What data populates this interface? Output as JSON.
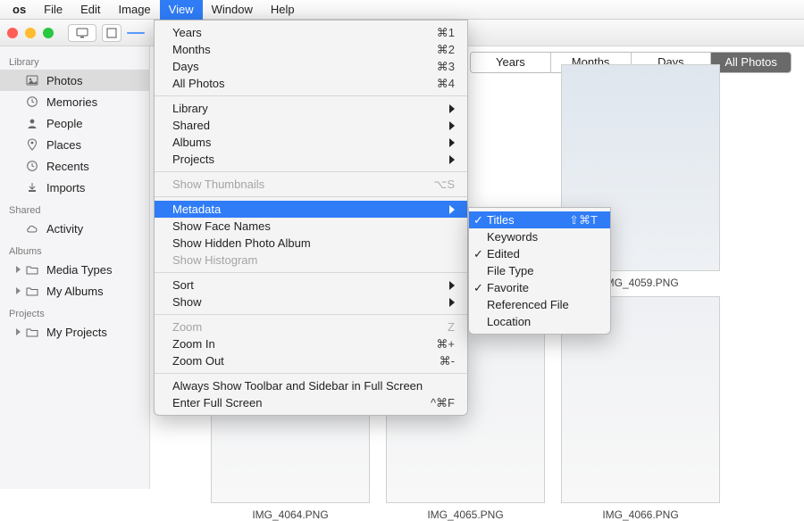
{
  "menubar": {
    "app": "os",
    "items": [
      "File",
      "Edit",
      "Image",
      "View",
      "Window",
      "Help"
    ],
    "active": "View"
  },
  "sidebar": {
    "groups": [
      {
        "header": "Library",
        "items": [
          {
            "label": "Photos",
            "icon": "photos-icon",
            "selected": true
          },
          {
            "label": "Memories",
            "icon": "clock-icon"
          },
          {
            "label": "People",
            "icon": "person-icon"
          },
          {
            "label": "Places",
            "icon": "pin-icon"
          },
          {
            "label": "Recents",
            "icon": "clock-icon"
          },
          {
            "label": "Imports",
            "icon": "download-icon"
          }
        ]
      },
      {
        "header": "Shared",
        "items": [
          {
            "label": "Activity",
            "icon": "cloud-icon"
          }
        ]
      },
      {
        "header": "Albums",
        "items": [
          {
            "label": "Media Types",
            "icon": "folder-icon",
            "disclosure": true
          },
          {
            "label": "My Albums",
            "icon": "folder-icon",
            "disclosure": true
          }
        ]
      },
      {
        "header": "Projects",
        "items": [
          {
            "label": "My Projects",
            "icon": "folder-icon",
            "disclosure": true
          }
        ]
      }
    ]
  },
  "segments": {
    "items": [
      "Years",
      "Months",
      "Days",
      "All Photos"
    ],
    "active": "All Photos"
  },
  "view_menu": [
    {
      "label": "Years",
      "shortcut": "⌘1"
    },
    {
      "label": "Months",
      "shortcut": "⌘2"
    },
    {
      "label": "Days",
      "shortcut": "⌘3"
    },
    {
      "label": "All Photos",
      "shortcut": "⌘4"
    },
    {
      "sep": true
    },
    {
      "label": "Library",
      "submenu": true
    },
    {
      "label": "Shared",
      "submenu": true
    },
    {
      "label": "Albums",
      "submenu": true
    },
    {
      "label": "Projects",
      "submenu": true
    },
    {
      "sep": true
    },
    {
      "label": "Show Thumbnails",
      "shortcut": "⌥S",
      "disabled": true
    },
    {
      "sep": true
    },
    {
      "label": "Metadata",
      "submenu": true,
      "highlight": true
    },
    {
      "label": "Show Face Names"
    },
    {
      "label": "Show Hidden Photo Album"
    },
    {
      "label": "Show Histogram",
      "disabled": true
    },
    {
      "sep": true
    },
    {
      "label": "Sort",
      "submenu": true
    },
    {
      "label": "Show",
      "submenu": true
    },
    {
      "sep": true
    },
    {
      "label": "Zoom",
      "shortcut": "Z",
      "disabled": true
    },
    {
      "label": "Zoom In",
      "shortcut": "⌘+"
    },
    {
      "label": "Zoom Out",
      "shortcut": "⌘-"
    },
    {
      "sep": true
    },
    {
      "label": "Always Show Toolbar and Sidebar in Full Screen"
    },
    {
      "label": "Enter Full Screen",
      "shortcut": "^⌘F"
    }
  ],
  "metadata_submenu": [
    {
      "label": "Titles",
      "checked": true,
      "highlight": true,
      "shortcut": "⇧⌘T"
    },
    {
      "label": "Keywords"
    },
    {
      "label": "Edited",
      "checked": true
    },
    {
      "label": "File Type"
    },
    {
      "label": "Favorite",
      "checked": true
    },
    {
      "label": "Referenced File"
    },
    {
      "label": "Location"
    }
  ],
  "thumbnails": [
    {
      "caption": "IMG_4059.PNG"
    },
    {
      "caption": "IMG_4064.PNG"
    },
    {
      "caption": "IMG_4065.PNG"
    },
    {
      "caption": "IMG_4066.PNG"
    }
  ]
}
